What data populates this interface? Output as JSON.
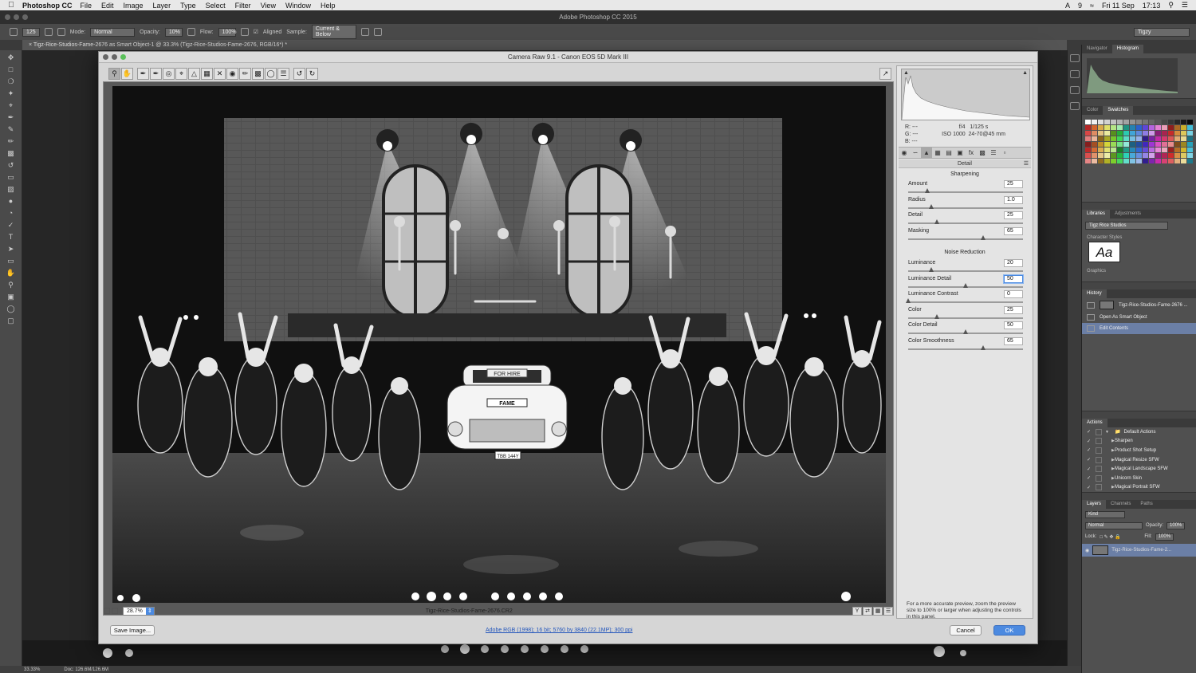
{
  "menubar": {
    "app_name": "Photoshop CC",
    "items": [
      "File",
      "Edit",
      "Image",
      "Layer",
      "Type",
      "Select",
      "Filter",
      "View",
      "Window",
      "Help"
    ],
    "right_status": [
      "9",
      "Fri 11 Sep",
      "17:13"
    ]
  },
  "window_title": "Adobe Photoshop CC 2015",
  "options_bar": {
    "brush_size": "125",
    "mode_label": "Mode:",
    "mode_value": "Normal",
    "opacity_label": "Opacity:",
    "opacity_value": "10%",
    "flow_label": "Flow:",
    "flow_value": "100%",
    "aligned_label": "Aligned",
    "sample_label": "Sample:",
    "sample_value": "Current & Below",
    "workspace": "Tigzy"
  },
  "doc_tab": "× Tigz-Rice-Studios-Fame-2676 as Smart Object-1 @ 33.3% (Tigz-Rice-Studios-Fame-2676, RGB/16*) *",
  "status_bar": {
    "zoom": "33.33%",
    "doc": "Doc: 126.6M/126.6M"
  },
  "camera_raw": {
    "title": "Camera Raw 9.1  -  Canon EOS 5D Mark III",
    "filename": "Tigz-Rice-Studios-Fame-2676.CR2",
    "zoom": "28.7%",
    "readout": {
      "r": "R:  ---",
      "g": "G:  ---",
      "b": "B:  ---",
      "aperture": "f/4",
      "shutter": "1/125 s",
      "iso": "ISO 1000",
      "lens": "24-70@45 mm"
    },
    "panel_title": "Detail",
    "sharpening": {
      "title": "Sharpening",
      "sliders": [
        {
          "label": "Amount",
          "value": "25",
          "pos": 0.17
        },
        {
          "label": "Radius",
          "value": "1.0",
          "pos": 0.2
        },
        {
          "label": "Detail",
          "value": "25",
          "pos": 0.25
        },
        {
          "label": "Masking",
          "value": "65",
          "pos": 0.65
        }
      ]
    },
    "noise_reduction": {
      "title": "Noise Reduction",
      "sliders": [
        {
          "label": "Luminance",
          "value": "20",
          "pos": 0.2
        },
        {
          "label": "Luminance Detail",
          "value": "50",
          "pos": 0.5,
          "focus": true
        },
        {
          "label": "Luminance Contrast",
          "value": "0",
          "pos": 0.0
        },
        {
          "label": "Color",
          "value": "25",
          "pos": 0.25
        },
        {
          "label": "Color Detail",
          "value": "50",
          "pos": 0.5
        },
        {
          "label": "Color Smoothness",
          "value": "65",
          "pos": 0.65
        }
      ]
    },
    "hint": "For a more accurate preview, zoom the preview size to 100% or larger when adjusting the controls in this panel.",
    "save_button": "Save Image...",
    "workflow_link": "Adobe RGB (1998); 16 bit; 5760 by 3840 (22.1MP); 300 ppi",
    "cancel_button": "Cancel",
    "ok_button": "OK",
    "photo_signs": {
      "car_sign": "FOR HIRE",
      "car_plate_top": "FAME",
      "plate": "TBB 144Y"
    }
  },
  "panels": {
    "navigator_tab": "Navigator",
    "histogram_tab": "Histogram",
    "color_tab": "Color",
    "swatches_tab": "Swatches",
    "libraries_tab": "Libraries",
    "adjustments_tab": "Adjustments",
    "library_name": "Tigz Rice Studios",
    "character_styles": "Character Styles",
    "aa": "Aa",
    "graphics": "Graphics",
    "history_title": "History",
    "history_snapshot": "Tigz-Rice-Studios-Fame-2676 ...",
    "history_items": [
      "Open As Smart Object",
      "Edit Contents"
    ],
    "actions_title": "Actions",
    "actions_set": "Default Actions",
    "actions": [
      "Sharpen",
      "Product Shot Setup",
      "Magical Resize SFW",
      "Magical Landscape SFW",
      "Unicorn Skin",
      "Magical Portrait SFW"
    ],
    "layers_tabs": [
      "Layers",
      "Channels",
      "Paths"
    ],
    "kind": "Kind",
    "blend": "Normal",
    "opacity_label": "Opacity:",
    "opacity": "100%",
    "lock_label": "Lock:",
    "fill_label": "Fill:",
    "fill": "100%",
    "layer_name": "Tigz-Rice-Studios-Fame-2..."
  }
}
